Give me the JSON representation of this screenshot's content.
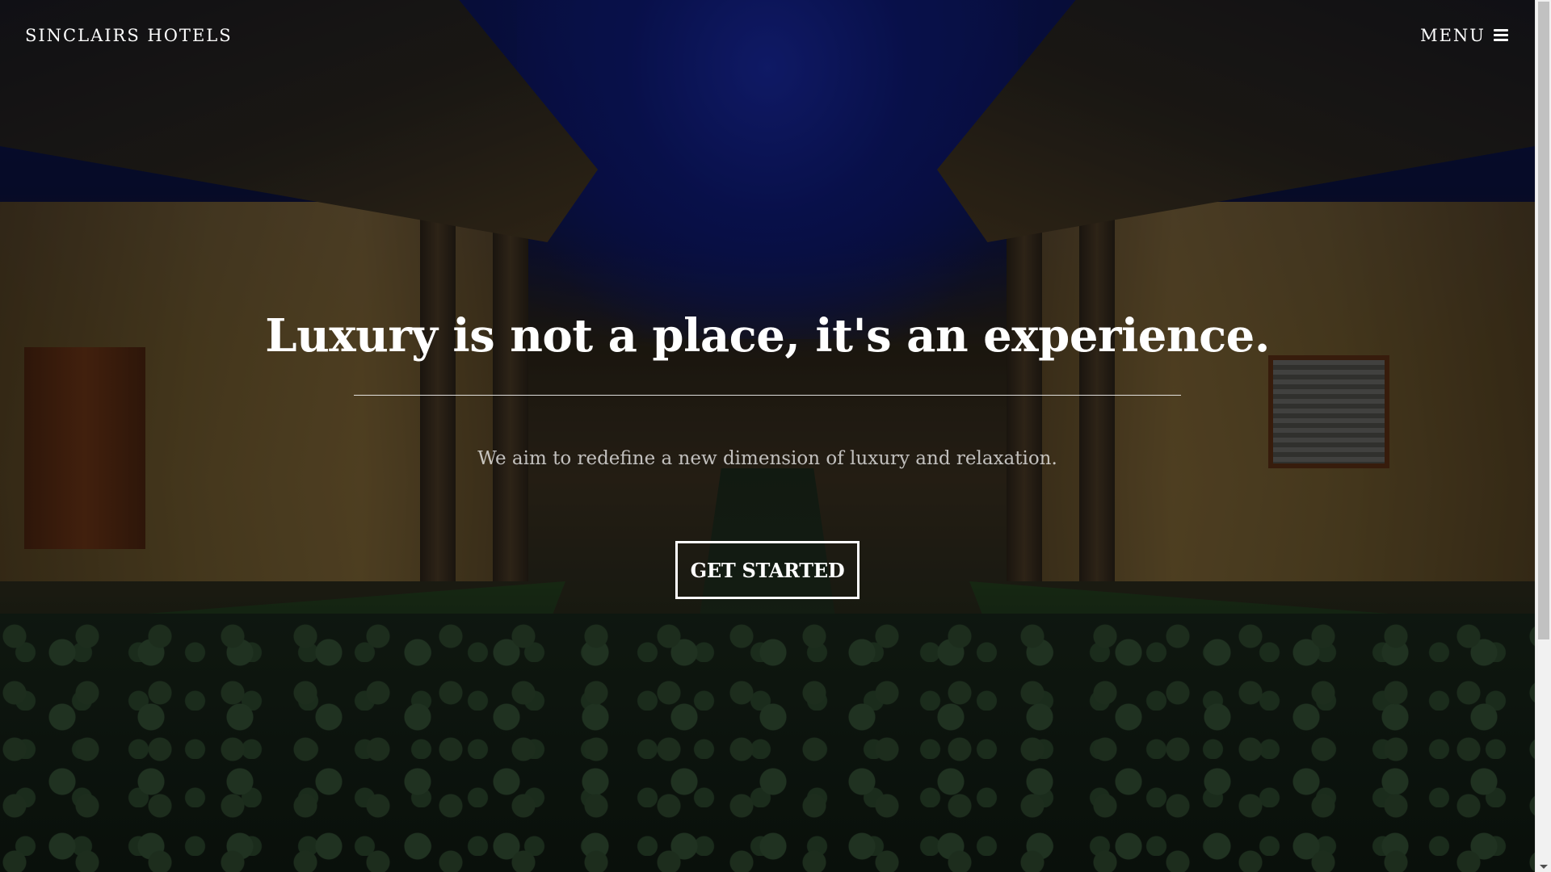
{
  "navbar": {
    "brand": "SINCLAIRS HOTELS",
    "menu_label": "MENU",
    "menu_icon": "bars-icon"
  },
  "hero": {
    "title": "Luxury is not a place, it's an experience.",
    "subtitle": "We aim to redefine a new dimension of luxury and relaxation.",
    "cta_label": "GET STARTED"
  },
  "background": {
    "description_icon": "resort-courtyard-image"
  },
  "colors": {
    "text": "#ffffff",
    "overlay": "#000000",
    "scrollbar_track": "#f1f1f1",
    "scrollbar_thumb": "#c1c1c1"
  }
}
